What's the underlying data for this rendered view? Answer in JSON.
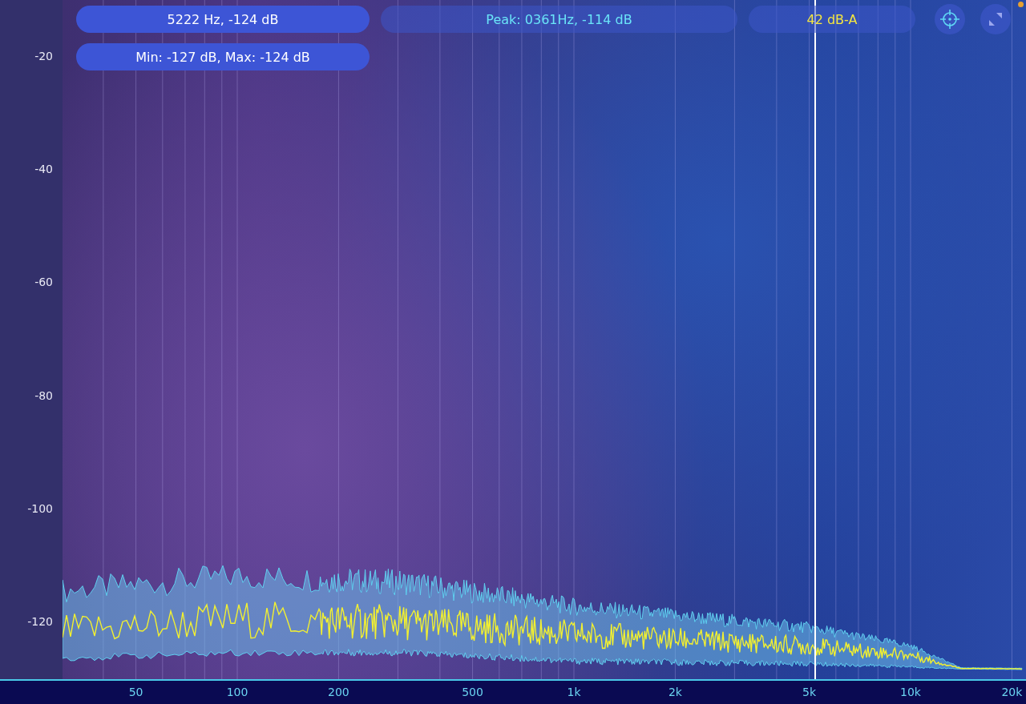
{
  "readouts": {
    "cursor": "5222 Hz, -124 dB",
    "min_max": "Min: -127 dB, Max: -124 dB",
    "peak": "Peak: 0361Hz, -114 dB",
    "level": "42 dB-A"
  },
  "y_axis": {
    "labels": [
      "-20",
      "-40",
      "-60",
      "-80",
      "-100",
      "-120"
    ]
  },
  "x_axis": {
    "labels": [
      "50",
      "100",
      "200",
      "500",
      "1k",
      "2k",
      "5k",
      "10k",
      "20k"
    ]
  }
}
